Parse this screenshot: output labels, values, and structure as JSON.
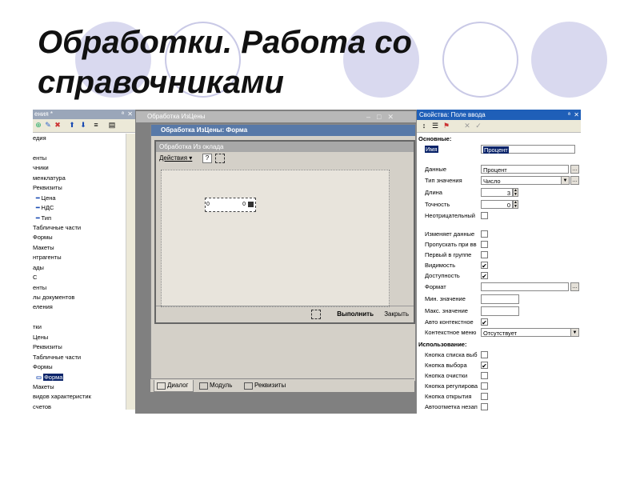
{
  "slide": {
    "title": "Обработки. Работа со справочниками",
    "circle_colors": [
      "#d9d9ef",
      "#ffffff",
      "#d9d9ef",
      "#ffffff",
      "#d9d9ef"
    ]
  },
  "tree_panel": {
    "title": "ения *",
    "items": [
      {
        "text": "едия",
        "icon": "",
        "selected": false
      },
      {
        "text": "",
        "icon": "",
        "selected": false
      },
      {
        "text": "енты",
        "icon": "",
        "selected": false
      },
      {
        "text": "чники",
        "icon": "",
        "selected": false
      },
      {
        "text": "менклатура",
        "icon": "",
        "selected": false
      },
      {
        "text": "Реквизиты",
        "icon": "",
        "selected": false
      },
      {
        "text": "Цена",
        "icon": "attribute-icon",
        "selected": false
      },
      {
        "text": "НДС",
        "icon": "attribute-icon",
        "selected": false
      },
      {
        "text": "Тип",
        "icon": "attribute-icon",
        "selected": false
      },
      {
        "text": "Табличные части",
        "icon": "",
        "selected": false
      },
      {
        "text": "Формы",
        "icon": "",
        "selected": false
      },
      {
        "text": "Макеты",
        "icon": "",
        "selected": false
      },
      {
        "text": "нтрагенты",
        "icon": "",
        "selected": false
      },
      {
        "text": "ады",
        "icon": "",
        "selected": false
      },
      {
        "text": "С",
        "icon": "",
        "selected": false
      },
      {
        "text": "енты",
        "icon": "",
        "selected": false
      },
      {
        "text": "лы документов",
        "icon": "",
        "selected": false
      },
      {
        "text": "еления",
        "icon": "",
        "selected": false
      },
      {
        "text": "",
        "icon": "",
        "selected": false
      },
      {
        "text": "тки",
        "icon": "",
        "selected": false
      },
      {
        "text": "Цены",
        "icon": "",
        "selected": false
      },
      {
        "text": "Реквизиты",
        "icon": "",
        "selected": false
      },
      {
        "text": "Табличные части",
        "icon": "",
        "selected": false
      },
      {
        "text": "Формы",
        "icon": "",
        "selected": false
      },
      {
        "text": "Форма",
        "icon": "form-icon",
        "selected": true
      },
      {
        "text": "Макеты",
        "icon": "",
        "selected": false
      },
      {
        "text": "видов характеристик",
        "icon": "",
        "selected": false
      },
      {
        "text": "счетов",
        "icon": "",
        "selected": false
      }
    ]
  },
  "designer": {
    "outer_title": "Обработка ИзЦены",
    "inner_title": "Обработка ИзЦены: Форма",
    "form_title": "Обработка  Из оклада",
    "actions_label": "Действия",
    "field_left": "0",
    "field_right": "0",
    "run_label": "Выполнить",
    "close_label": "Закрыть",
    "tabs": [
      "Диалог",
      "Модуль",
      "Реквизиты"
    ]
  },
  "properties": {
    "title": "Свойства: Поле ввода",
    "section_basic": "Основные:",
    "name_label": "Имя",
    "name_value": "Процент",
    "data_label": "Данные",
    "data_value": "Процент",
    "type_label": "Тип значения",
    "type_value": "Число",
    "length_label": "Длина",
    "length_value": "3",
    "precision_label": "Точность",
    "precision_value": "0",
    "nonneg_label": "Неотрицательный",
    "changes_label": "Изменяет данные",
    "skip_label": "Пропускать при вв",
    "first_label": "Первый в группе",
    "visible_label": "Видимость",
    "enabled_label": "Доступность",
    "format_label": "Формат",
    "min_label": "Мин. значение",
    "max_label": "Макс. значение",
    "autocontext_label": "Авто контекстное",
    "context_label": "Контекстное меню",
    "context_value": "Отсутствует",
    "section_usage": "Использование:",
    "list_btn_label": "Кнопка списка выб",
    "choice_btn_label": "Кнопка выбора",
    "clear_btn_label": "Кнопка очистки",
    "adjust_btn_label": "Кнопка регулирова",
    "open_btn_label": "Кнопка открытия",
    "automark_label": "Автоотметка незап"
  }
}
